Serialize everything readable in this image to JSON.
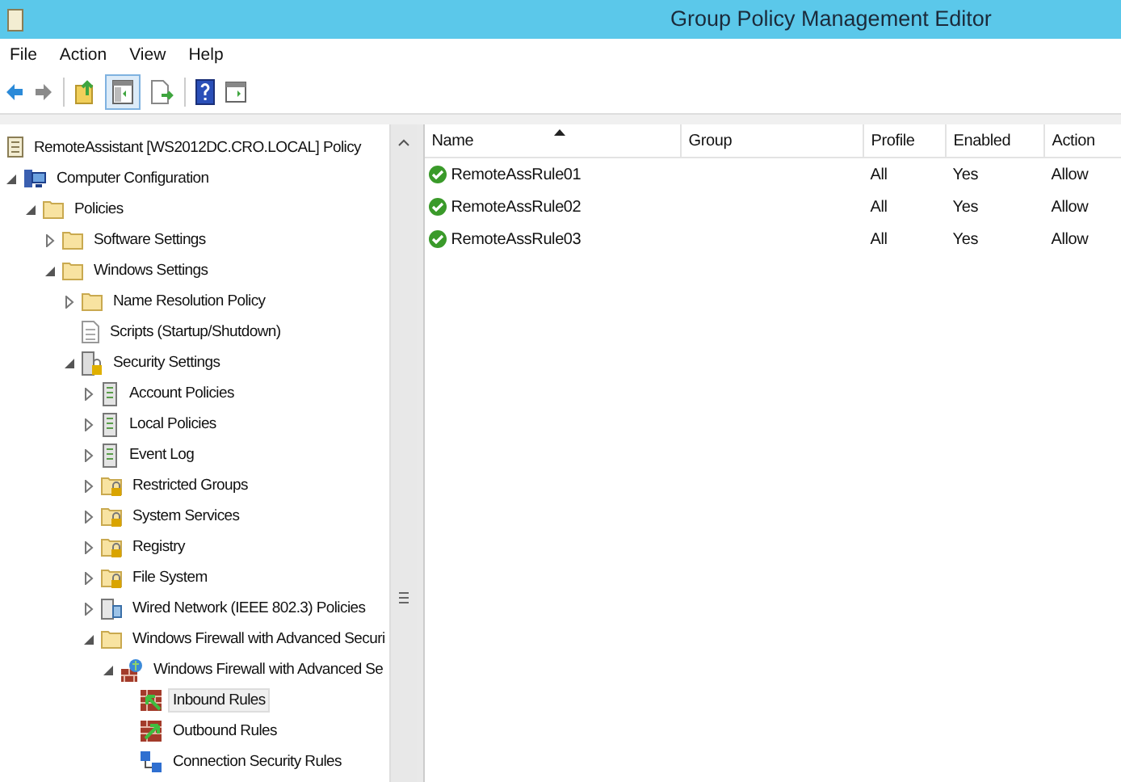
{
  "window": {
    "title": "Group Policy Management Editor"
  },
  "menu": [
    "File",
    "Action",
    "View",
    "Help"
  ],
  "tree": {
    "label": "RemoteAssistant [WS2012DC.CRO.LOCAL] Policy",
    "kind": "policy",
    "children": [
      {
        "label": "Computer Configuration",
        "kind": "computer",
        "expanded": true,
        "selected": false,
        "children": [
          {
            "label": "Policies",
            "kind": "folder",
            "expanded": true,
            "selected": false,
            "children": [
              {
                "label": "Software Settings",
                "kind": "folder",
                "expanded": false,
                "selected": false
              },
              {
                "label": "Windows Settings",
                "kind": "folder",
                "expanded": true,
                "selected": false,
                "children": [
                  {
                    "label": "Name Resolution Policy",
                    "kind": "folder",
                    "expanded": false,
                    "selected": false
                  },
                  {
                    "label": "Scripts (Startup/Shutdown)",
                    "kind": "script",
                    "selected": false
                  },
                  {
                    "label": "Security Settings",
                    "kind": "security",
                    "expanded": true,
                    "selected": false,
                    "children": [
                      {
                        "label": "Account Policies",
                        "kind": "server",
                        "expanded": false,
                        "selected": false
                      },
                      {
                        "label": "Local Policies",
                        "kind": "server",
                        "expanded": false,
                        "selected": false
                      },
                      {
                        "label": "Event Log",
                        "kind": "server",
                        "expanded": false,
                        "selected": false
                      },
                      {
                        "label": "Restricted Groups",
                        "kind": "locked-folder",
                        "expanded": false,
                        "selected": false
                      },
                      {
                        "label": "System Services",
                        "kind": "locked-folder",
                        "expanded": false,
                        "selected": false
                      },
                      {
                        "label": "Registry",
                        "kind": "locked-folder",
                        "expanded": false,
                        "selected": false
                      },
                      {
                        "label": "File System",
                        "kind": "locked-folder",
                        "expanded": false,
                        "selected": false
                      },
                      {
                        "label": "Wired Network (IEEE 802.3) Policies",
                        "kind": "network",
                        "expanded": false,
                        "selected": false
                      },
                      {
                        "label": "Windows Firewall with Advanced Securi",
                        "kind": "folder",
                        "expanded": true,
                        "selected": false,
                        "children": [
                          {
                            "label": "Windows Firewall with Advanced Se",
                            "kind": "firewall",
                            "expanded": true,
                            "selected": false,
                            "children": [
                              {
                                "label": "Inbound Rules",
                                "kind": "inbound",
                                "selected": true
                              },
                              {
                                "label": "Outbound Rules",
                                "kind": "outbound",
                                "selected": false
                              },
                              {
                                "label": "Connection Security Rules",
                                "kind": "connection",
                                "selected": false
                              }
                            ]
                          }
                        ]
                      }
                    ]
                  }
                ]
              }
            ]
          }
        ]
      }
    ]
  },
  "table": {
    "columns": [
      {
        "label": "Name",
        "sorted": true
      },
      {
        "label": "Group",
        "sorted": false
      },
      {
        "label": "Profile",
        "sorted": false
      },
      {
        "label": "Enabled",
        "sorted": false
      },
      {
        "label": "Action",
        "sorted": false
      }
    ],
    "rows": [
      {
        "name": "RemoteAssRule01",
        "profile": "All",
        "enabled": "Yes",
        "action": "Allow"
      },
      {
        "name": "RemoteAssRule02",
        "profile": "All",
        "enabled": "Yes",
        "action": "Allow"
      },
      {
        "name": "RemoteAssRule03",
        "profile": "All",
        "enabled": "Yes",
        "action": "Allow"
      }
    ]
  }
}
